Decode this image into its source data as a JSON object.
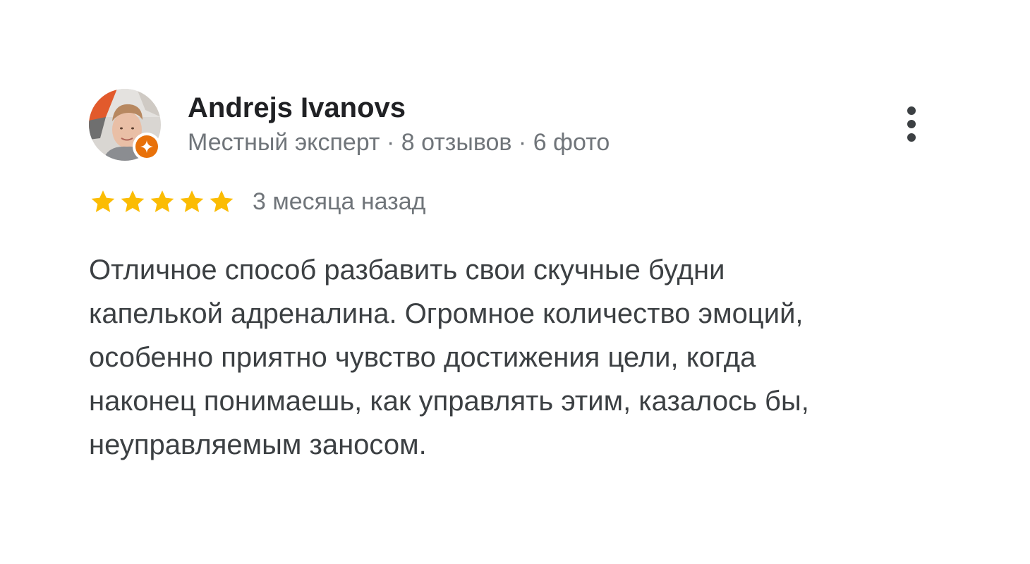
{
  "reviewer": {
    "name": "Andrejs Ivanovs",
    "meta": "Местный эксперт · 8 отзывов · 6 фото"
  },
  "rating": {
    "stars": 5,
    "max_stars": 5,
    "time": "3 месяца назад",
    "star_color": "#fbbc04"
  },
  "review": {
    "lines": [
      "Отличное способ разбавить свои скучные будни",
      "капелькой адреналина. Огромное количество эмоций,",
      "особенно приятно чувство достижения цели, когда",
      "наконец понимаешь, как управлять этим, казалось бы,",
      "неуправляемым заносом."
    ]
  },
  "icons": {
    "badge": "local-guide-badge-icon",
    "more": "more-vert-icon",
    "star": "star-icon"
  },
  "colors": {
    "badge": "#e8710a",
    "text": "#3c4043",
    "name": "#202124",
    "muted": "#70757a"
  }
}
